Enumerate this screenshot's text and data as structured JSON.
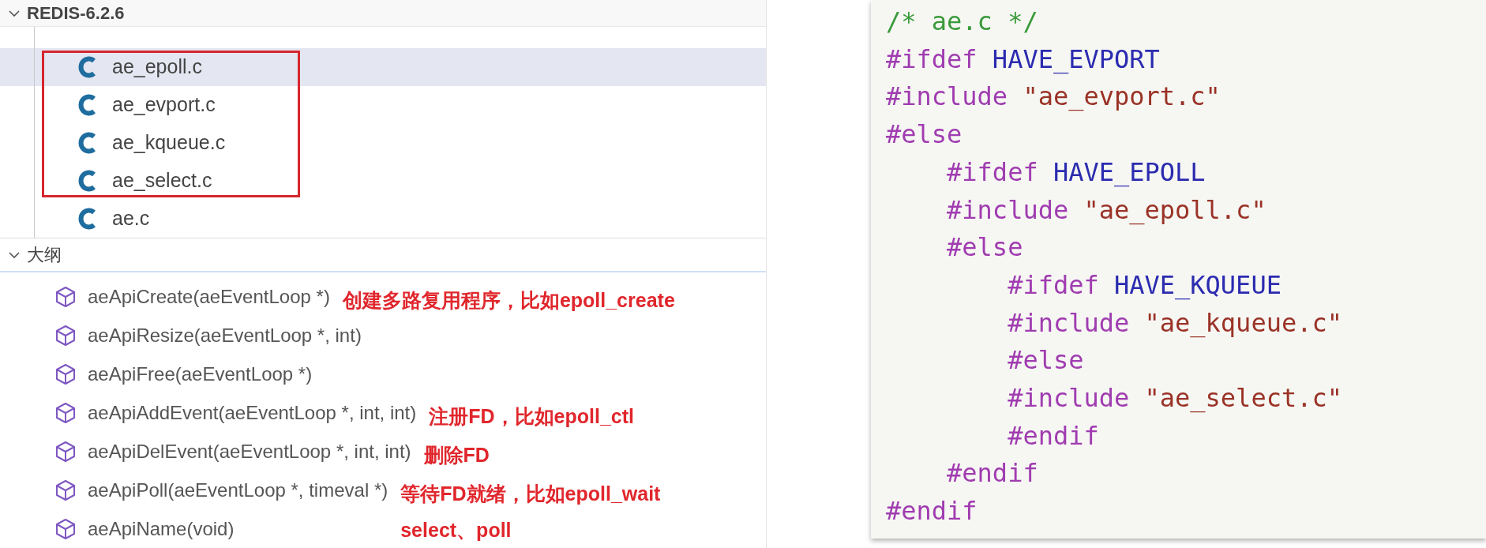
{
  "explorer": {
    "title": "REDIS-6.2.6",
    "expanded": true,
    "files": [
      {
        "name": "ae_epoll.c",
        "selected": true
      },
      {
        "name": "ae_evport.c",
        "selected": false
      },
      {
        "name": "ae_kqueue.c",
        "selected": false
      },
      {
        "name": "ae_select.c",
        "selected": false
      },
      {
        "name": "ae.c",
        "selected": false
      }
    ]
  },
  "outline": {
    "title": "大纲",
    "expanded": true,
    "items": [
      {
        "signature": "aeApiCreate(aeEventLoop *)",
        "note": [
          "创建多路复用程序，比如epoll_create"
        ]
      },
      {
        "signature": "aeApiResize(aeEventLoop *, int)"
      },
      {
        "signature": "aeApiFree(aeEventLoop *)"
      },
      {
        "signature": "aeApiAddEvent(aeEventLoop *, int, int)",
        "note": [
          "注册FD，比如epoll_ctl"
        ]
      },
      {
        "signature": "aeApiDelEvent(aeEventLoop *, int, int)",
        "note": [
          "删除FD"
        ]
      },
      {
        "signature": "aeApiPoll(aeEventLoop *, timeval *)",
        "note": [
          "等待FD就绪，比如epoll_wait",
          "select、poll"
        ]
      },
      {
        "signature": "aeApiName(void)"
      }
    ]
  },
  "code": [
    [
      {
        "kind": "comment",
        "text": "/* ae.c */"
      }
    ],
    [
      {
        "kind": "directive",
        "text": "#ifdef "
      },
      {
        "kind": "macro",
        "text": "HAVE_EVPORT"
      }
    ],
    [
      {
        "kind": "directive",
        "text": "#include "
      },
      {
        "kind": "string",
        "text": "\"ae_evport.c\""
      }
    ],
    [
      {
        "kind": "directive",
        "text": "#else"
      }
    ],
    [
      {
        "kind": "directive",
        "text": "    #ifdef "
      },
      {
        "kind": "macro",
        "text": "HAVE_EPOLL"
      }
    ],
    [
      {
        "kind": "directive",
        "text": "    #include "
      },
      {
        "kind": "string",
        "text": "\"ae_epoll.c\""
      }
    ],
    [
      {
        "kind": "directive",
        "text": "    #else"
      }
    ],
    [
      {
        "kind": "directive",
        "text": "        #ifdef "
      },
      {
        "kind": "macro",
        "text": "HAVE_KQUEUE"
      }
    ],
    [
      {
        "kind": "directive",
        "text": "        #include "
      },
      {
        "kind": "string",
        "text": "\"ae_kqueue.c\""
      }
    ],
    [
      {
        "kind": "directive",
        "text": "        #else"
      }
    ],
    [
      {
        "kind": "directive",
        "text": "        #include "
      },
      {
        "kind": "string",
        "text": "\"ae_select.c\""
      }
    ],
    [
      {
        "kind": "directive",
        "text": "        #endif"
      }
    ],
    [
      {
        "kind": "directive",
        "text": "    #endif"
      }
    ],
    [
      {
        "kind": "directive",
        "text": "#endif"
      }
    ]
  ]
}
